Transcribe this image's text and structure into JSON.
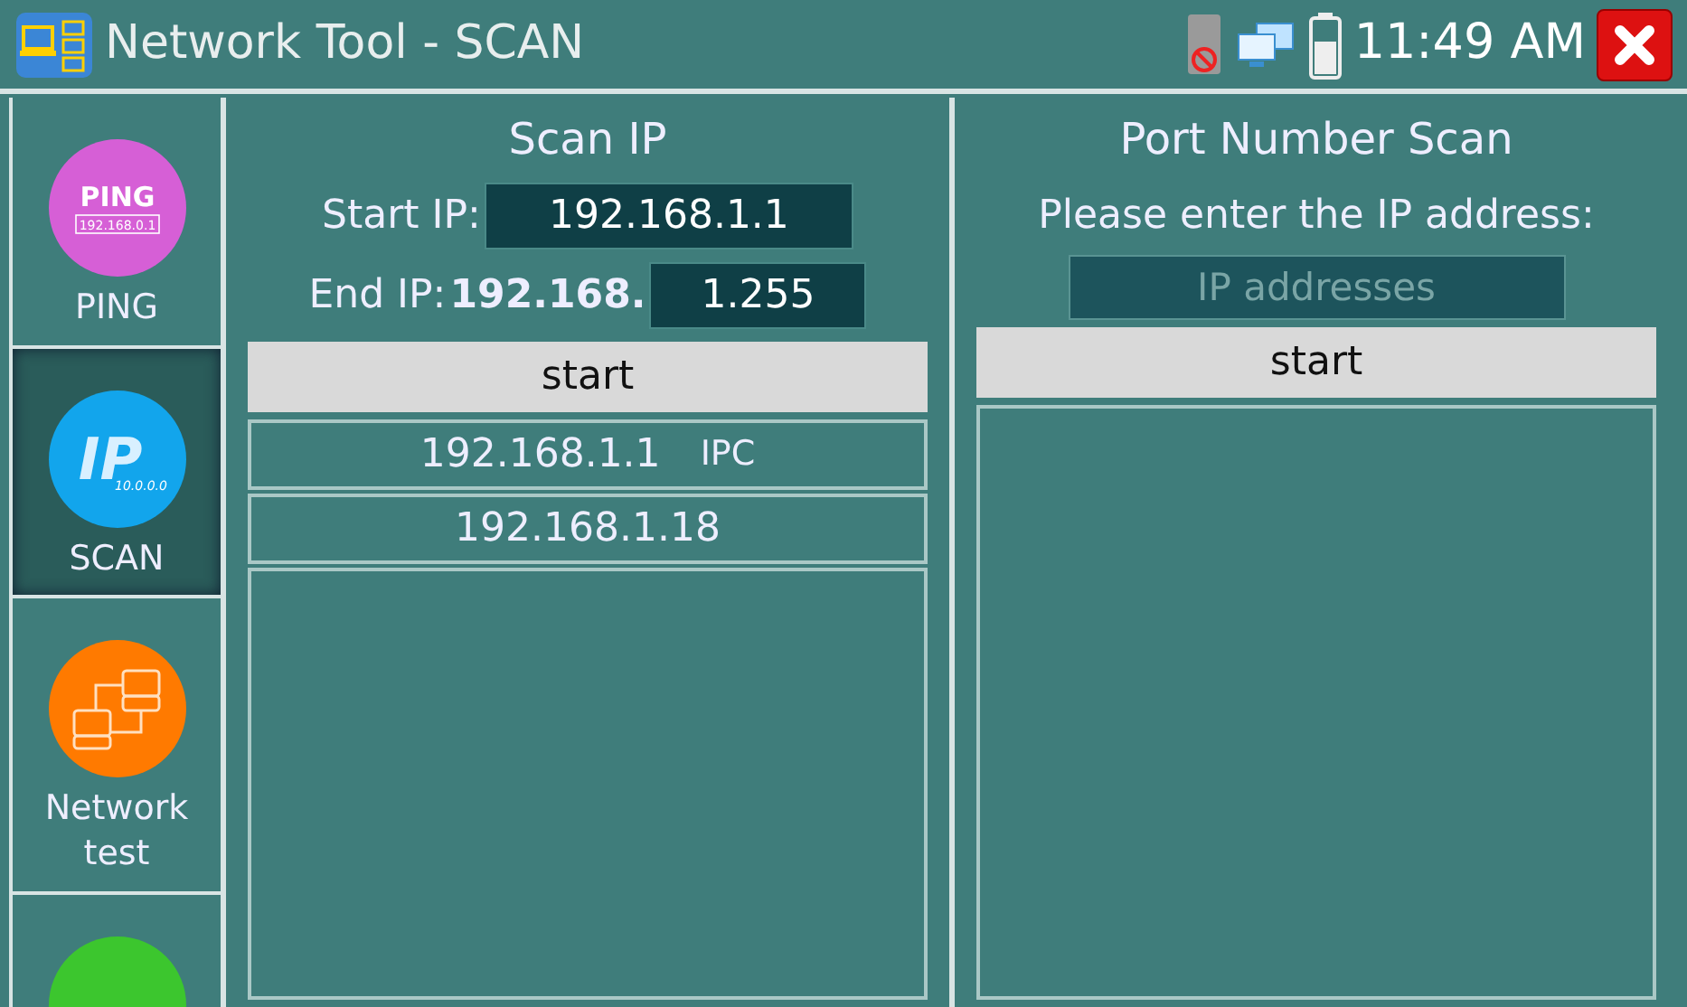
{
  "window": {
    "title": "Network Tool - SCAN",
    "time": "11:49 AM"
  },
  "sidebar": {
    "items": [
      {
        "kind": "ping",
        "label": "PING",
        "icon_text": "PING",
        "icon_subtext": "192.168.0.1",
        "color": "#d65fd6",
        "selected": false
      },
      {
        "kind": "ip",
        "label": "SCAN",
        "icon_text": "IP",
        "icon_subtext": "10.0.0.0",
        "color": "#12a5ec",
        "selected": true
      },
      {
        "kind": "network",
        "label": "Network test",
        "color": "#ff7a00",
        "selected": false
      },
      {
        "kind": "other",
        "color": "#3cc62e",
        "selected": false
      }
    ]
  },
  "scan_ip": {
    "title": "Scan IP",
    "start_label": "Start IP:",
    "start_value": "192.168.1.1",
    "end_label": "End IP:",
    "end_prefix": "192.168.",
    "end_value": "1.255",
    "button": "start",
    "results": [
      {
        "ip": "192.168.1.1",
        "type": "IPC"
      },
      {
        "ip": "192.168.1.18"
      }
    ]
  },
  "port_scan": {
    "title": "Port Number Scan",
    "prompt": "Please enter the IP address:",
    "placeholder": "IP addresses",
    "button": "start"
  }
}
